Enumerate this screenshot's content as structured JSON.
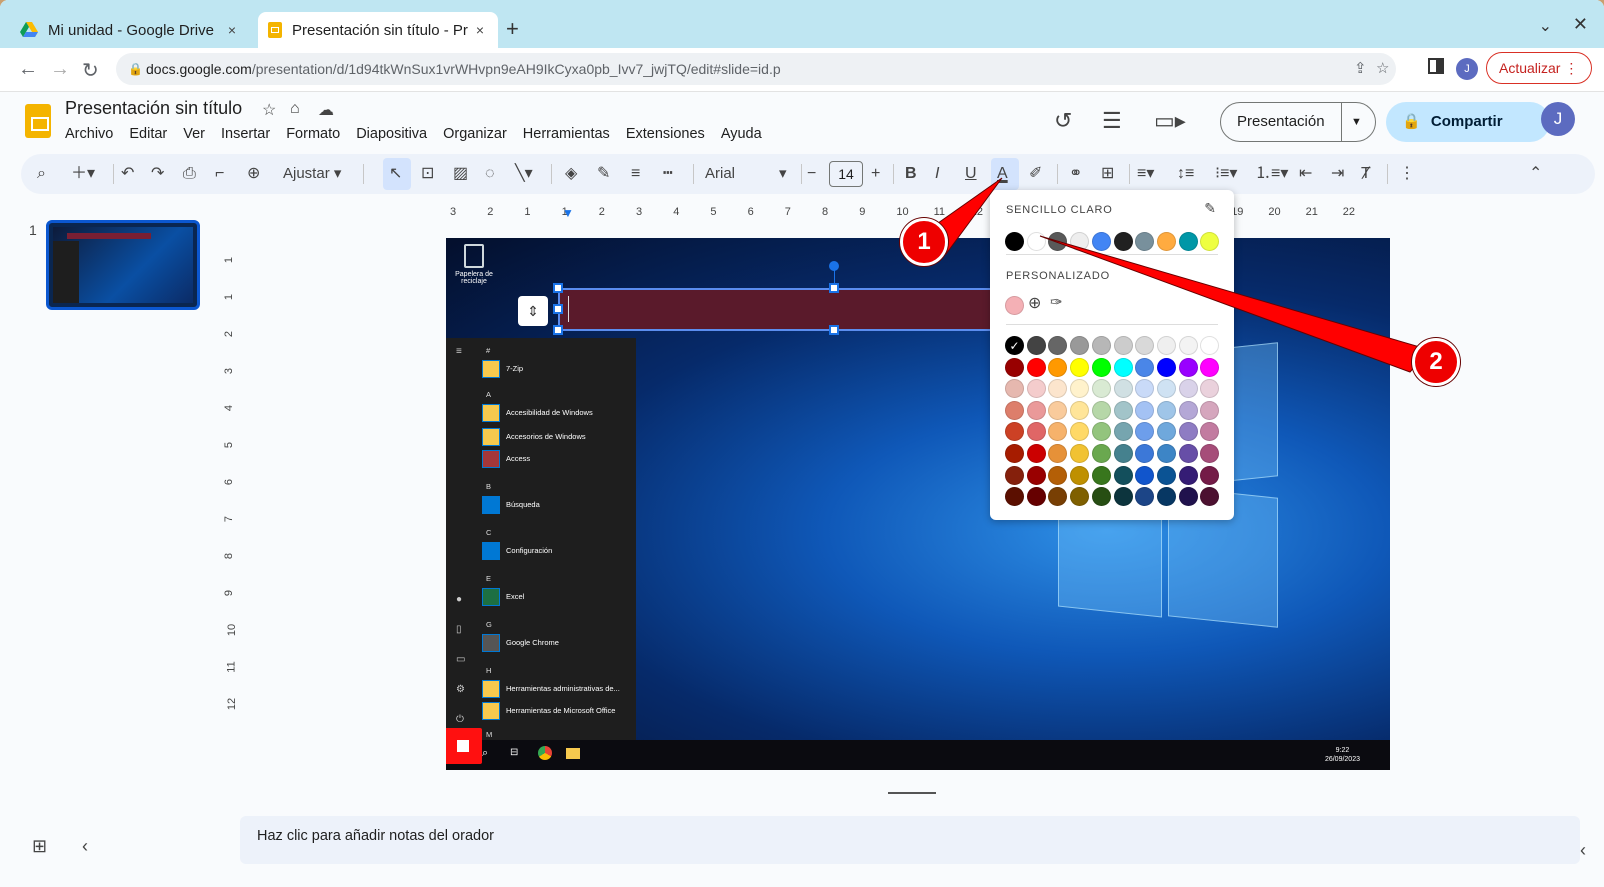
{
  "browser": {
    "tabs": [
      {
        "title": "Mi unidad - Google Drive",
        "close": "×"
      },
      {
        "title": "Presentación sin título - Pr",
        "close": "×"
      }
    ],
    "new_tab": "+",
    "tabs_menu": "⌄",
    "close_window": "✕",
    "url_host": "docs.google.com",
    "url_path": "/presentation/d/1d94tkWnSux1vrWHvpn9eAH9IkCyxa0pb_Ivv7_jwjTQ/edit#slide=id.p",
    "update_label": "Actualizar",
    "profile_initial": "J"
  },
  "app": {
    "title": "Presentación sin título",
    "menus": [
      "Archivo",
      "Editar",
      "Ver",
      "Insertar",
      "Formato",
      "Diapositiva",
      "Organizar",
      "Herramientas",
      "Extensiones",
      "Ayuda"
    ],
    "present_label": "Presentación",
    "share_label": "Compartir",
    "avatar_initial": "J"
  },
  "toolbar": {
    "zoom_label": "Ajustar",
    "font_name": "Arial",
    "font_size": "14"
  },
  "filmstrip": {
    "slide_number": "1"
  },
  "ruler": {
    "h_ticks": [
      "3",
      "2",
      "1",
      "1",
      "2",
      "3",
      "4",
      "5",
      "6",
      "7",
      "8",
      "9",
      "10",
      "11",
      "12",
      "13",
      "14",
      "15",
      "16",
      "17",
      "18",
      "19",
      "20",
      "21",
      "22"
    ],
    "v_ticks": [
      "1",
      "1",
      "2",
      "3",
      "4",
      "5",
      "6",
      "7",
      "8",
      "9",
      "10",
      "11",
      "12"
    ]
  },
  "slide": {
    "recycle_label": "Papelera de reciclaje",
    "start_sections": [
      {
        "letter": "#",
        "items": [
          "7-Zip"
        ]
      },
      {
        "letter": "A",
        "items": [
          "Accesibilidad de Windows",
          "Accesorios de Windows",
          "Access"
        ]
      },
      {
        "letter": "B",
        "items": [
          "Búsqueda"
        ]
      },
      {
        "letter": "C",
        "items": [
          "Configuración"
        ]
      },
      {
        "letter": "E",
        "items": [
          "Excel"
        ]
      },
      {
        "letter": "G",
        "items": [
          "Google Chrome"
        ]
      },
      {
        "letter": "H",
        "items": [
          "Herramientas administrativas de...",
          "Herramientas de Microsoft Office"
        ]
      },
      {
        "letter": "M",
        "items": []
      }
    ],
    "clock_time": "9:22",
    "clock_date": "26/09/2023"
  },
  "palette": {
    "header_simple": "SENCILLO CLARO",
    "header_custom": "PERSONALIZADO",
    "simple_colors": [
      "#000000",
      "#ffffff",
      "#595959",
      "#eeeeee",
      "#4285f4",
      "#212121",
      "#78909c",
      "#ffab40",
      "#0097a7",
      "#eeff41"
    ],
    "custom_colors": [
      "#f4b0b5"
    ],
    "grid": [
      [
        "#000000",
        "#434343",
        "#666666",
        "#999999",
        "#b7b7b7",
        "#cccccc",
        "#d9d9d9",
        "#efefef",
        "#f3f3f3",
        "#ffffff"
      ],
      [
        "#980000",
        "#ff0000",
        "#ff9900",
        "#ffff00",
        "#00ff00",
        "#00ffff",
        "#4a86e8",
        "#0000ff",
        "#9900ff",
        "#ff00ff"
      ],
      [
        "#e6b8af",
        "#f4cccc",
        "#fce5cd",
        "#fff2cc",
        "#d9ead3",
        "#d0e0e3",
        "#c9daf8",
        "#cfe2f3",
        "#d9d2e9",
        "#ead1dc"
      ],
      [
        "#dd7e6b",
        "#ea9999",
        "#f9cb9c",
        "#ffe599",
        "#b6d7a8",
        "#a2c4c9",
        "#a4c2f4",
        "#9fc5e8",
        "#b4a7d6",
        "#d5a6bd"
      ],
      [
        "#cc4125",
        "#e06666",
        "#f6b26b",
        "#ffd966",
        "#93c47d",
        "#76a5af",
        "#6d9eeb",
        "#6fa8dc",
        "#8e7cc3",
        "#c27ba0"
      ],
      [
        "#a61c00",
        "#cc0000",
        "#e69138",
        "#f1c232",
        "#6aa84f",
        "#45818e",
        "#3c78d8",
        "#3d85c6",
        "#674ea7",
        "#a64d79"
      ],
      [
        "#85200c",
        "#990000",
        "#b45f06",
        "#bf9000",
        "#38761d",
        "#134f5c",
        "#1155cc",
        "#0b5394",
        "#351c75",
        "#741b47"
      ],
      [
        "#5b0f00",
        "#660000",
        "#783f04",
        "#7f6000",
        "#274e13",
        "#0c343d",
        "#1c4587",
        "#073763",
        "#20124d",
        "#4c1130"
      ]
    ]
  },
  "notes": {
    "placeholder": "Haz clic para añadir notas del orador"
  },
  "annotations": {
    "step1": "1",
    "step2": "2",
    "accent": "#ff0000"
  }
}
